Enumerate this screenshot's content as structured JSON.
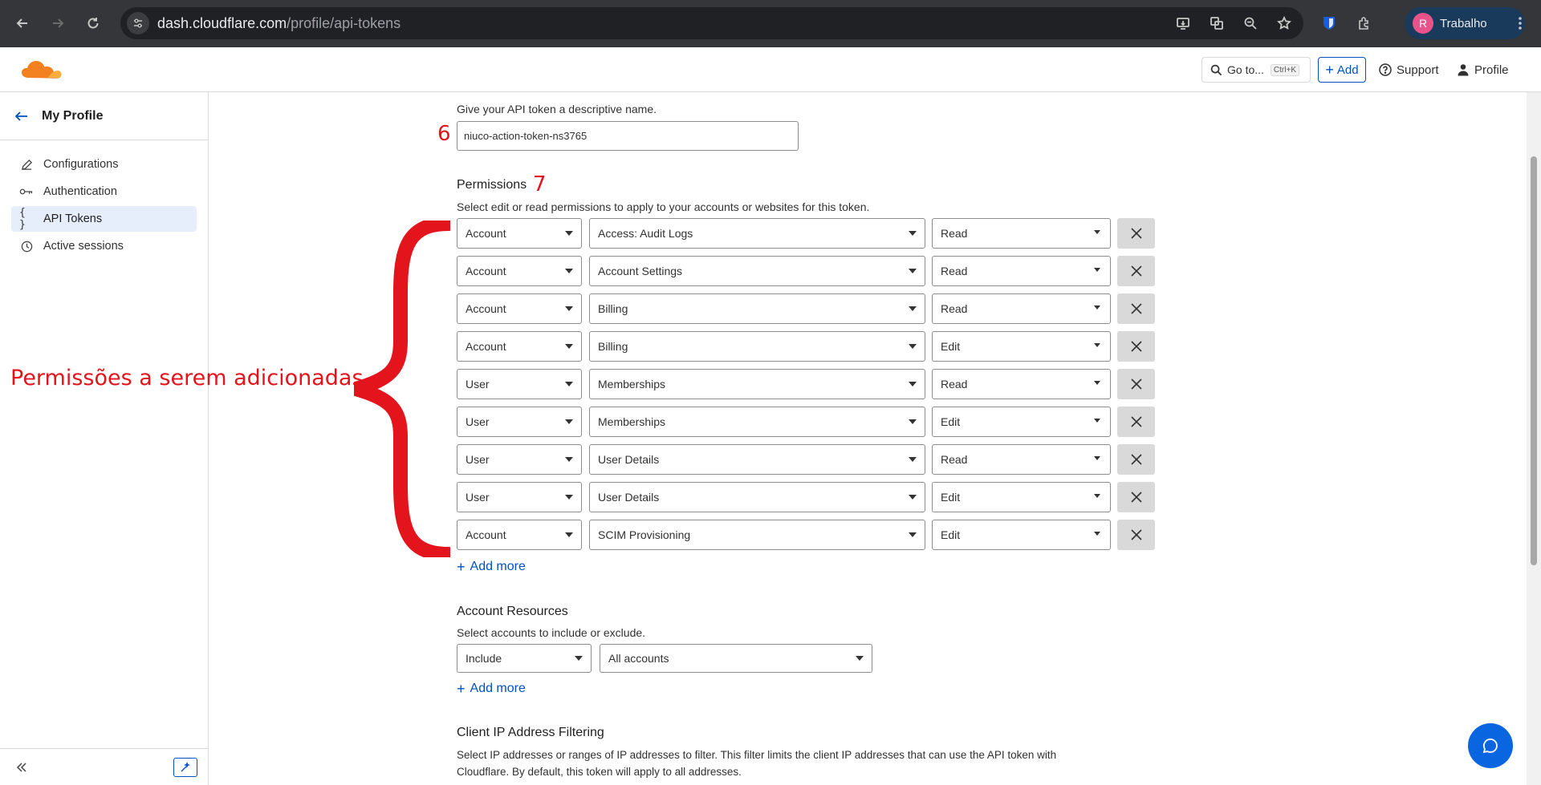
{
  "browser": {
    "url_domain": "dash.cloudflare.com",
    "url_path": "/profile/api-tokens",
    "profile_initial": "R",
    "profile_name": "Trabalho"
  },
  "header": {
    "goto_label": "Go to...",
    "goto_shortcut": "Ctrl+K",
    "add_label": "Add",
    "support_label": "Support",
    "profile_label": "Profile"
  },
  "sidebar": {
    "title": "My Profile",
    "items": [
      {
        "label": "Configurations",
        "icon": "pencil-icon"
      },
      {
        "label": "Authentication",
        "icon": "key-icon"
      },
      {
        "label": "API Tokens",
        "icon": "braces-icon"
      },
      {
        "label": "Active sessions",
        "icon": "clock-icon"
      }
    ]
  },
  "token_name": {
    "hint": "Give your API token a descriptive name.",
    "value": "niuco-action-token-ns3765"
  },
  "permissions": {
    "title": "Permissions",
    "description": "Select edit or read permissions to apply to your accounts or websites for this token.",
    "rows": [
      {
        "scope": "Account",
        "resource": "Access: Audit Logs",
        "level": "Read"
      },
      {
        "scope": "Account",
        "resource": "Account Settings",
        "level": "Read"
      },
      {
        "scope": "Account",
        "resource": "Billing",
        "level": "Read"
      },
      {
        "scope": "Account",
        "resource": "Billing",
        "level": "Edit"
      },
      {
        "scope": "User",
        "resource": "Memberships",
        "level": "Read"
      },
      {
        "scope": "User",
        "resource": "Memberships",
        "level": "Edit"
      },
      {
        "scope": "User",
        "resource": "User Details",
        "level": "Read"
      },
      {
        "scope": "User",
        "resource": "User Details",
        "level": "Edit"
      },
      {
        "scope": "Account",
        "resource": "SCIM Provisioning",
        "level": "Edit"
      }
    ],
    "add_more": "Add more"
  },
  "account_resources": {
    "title": "Account Resources",
    "description": "Select accounts to include or exclude.",
    "mode": "Include",
    "target": "All accounts",
    "add_more": "Add more"
  },
  "ip_filtering": {
    "title": "Client IP Address Filtering",
    "description_line1": "Select IP addresses or ranges of IP addresses to filter. This filter limits the client IP addresses that can use the API token with",
    "description_line2": "Cloudflare. By default, this token will apply to all addresses."
  },
  "annotations": {
    "step6": "6",
    "step7": "7",
    "brace_label": "Permissões a serem adicionadas",
    "color": "#e3141b"
  }
}
